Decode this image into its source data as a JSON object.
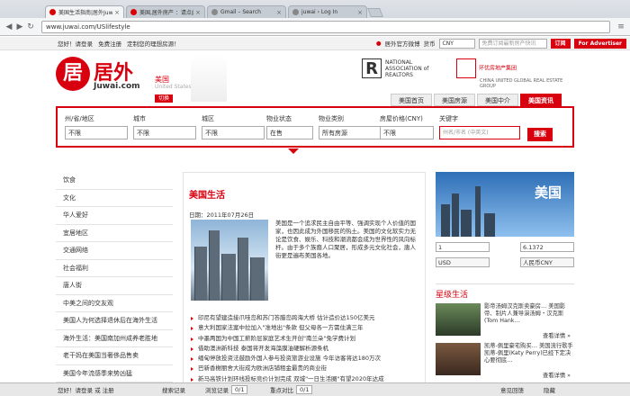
{
  "browser": {
    "tabs": [
      "美国生活指南|居外Juwai.co",
      "美国,居外房产 ：请点此分",
      "Gmail – Search",
      "juwai › Log In"
    ],
    "url": "www.juwai.com/USlifestyle"
  },
  "topbar": {
    "greeting": "您好！请登录",
    "free_reg": "免费注册",
    "custom": "定制您的理想房源！",
    "weibo": "居外官方微博",
    "currency_label": "货币",
    "currency": "CNY",
    "sub_placeholder": "免费订阅最新房产快讯",
    "subscribe": "订阅",
    "advertiser": "For Advertiser"
  },
  "header": {
    "logo_char": "居",
    "brand": "居外",
    "brand_sub": "Juwai.com",
    "region": "美国",
    "region_en": "United States",
    "switch": "切换",
    "realtor": "NATIONAL ASSOCIATION of REALTORS",
    "realtor_mark": "R",
    "ugre": "环优房地产集团",
    "ugre_en": "CHINA UNITED GLOBAL REAL ESTATE GROUP"
  },
  "nav": [
    "美国首页",
    "美国房源",
    "美国中介",
    "美国资讯"
  ],
  "search": {
    "fields": [
      {
        "label": "州/省/地区",
        "value": "不限"
      },
      {
        "label": "城市",
        "value": "不限"
      },
      {
        "label": "城区",
        "value": "不限"
      },
      {
        "label": "物业状态",
        "value": "在售"
      },
      {
        "label": "物业类别",
        "value": "所有房源"
      },
      {
        "label": "房屋价格(CNY)",
        "value": "不限"
      }
    ],
    "keyword_label": "关键字",
    "keyword_placeholder": "州名/市名 (中英文)",
    "button": "搜索"
  },
  "sidebar": [
    "饮食",
    "文化",
    "华人爱好",
    "宜居地区",
    "交通网络",
    "社会福利",
    "唐人街",
    "中美之间的交友观",
    "美国人为何选择退休后在海外生活",
    "海外生活：美国南加州成养老胜地",
    "老干妈在美国当奢侈品售卖",
    "美国今年流感季来势凶猛"
  ],
  "article": {
    "title": "美国生活",
    "date": "日期：2011年07月26日",
    "body": "美国是一个追求民主自由平等、强调实现个人价值的国家，也因此成为外国移民的热土。美国的文化软实力无论是饮食、娱乐、科技和潮流都会成为世界性的风向标杆。由于多个族裔人口聚居，形成多元文化社会，唐人街更是遍布美国各地。",
    "links": [
      "印尼有望建造接爪哇岛和苏门答腊岛跨海大桥 估计造价达150亿美元",
      "意大利国家法案中拉加入\"准地出\"条款 但父母各一方需住满三年",
      "中墨两国为中国工薪阶层家庭艺术生开创\"南兰朵\"免学费计划",
      "借助澳洲新科技 泰国将开发海藻膜油硬解析源条机",
      "缅甸停放投资法鼓励外国人参与投资旅游业设施 今年访客将达180万次",
      "巴新香榭丽舍大街成为欧洲店铺租金最贵的商业街",
      "新马高铁计划环线投标竞价计划完成 双城\"一日生活圈\"有望2020年达成"
    ]
  },
  "right": {
    "country": "美国",
    "amount": "1",
    "rate": "6.1372",
    "from": "USD",
    "to": "人民币CNY",
    "section": "星级生活",
    "items": [
      {
        "text": "影帝汤姆汉克斯卖豪房… 美国影帝、制片人兼导演汤姆・汉克斯(Tom Hank…",
        "more": "查看详情 »"
      },
      {
        "text": "凯蒂-佩里豪宅购买… 美国流行歌手凯蒂-佩里(Katy Perry)已经下定决心要彻底…",
        "more": "查看详情 »"
      }
    ]
  },
  "bottom": {
    "greeting": "您好！请登录 或 注册",
    "search_log": "搜索记录",
    "browse_log": "浏览记录",
    "browse_count": "0/1",
    "compare_log": "重点对比",
    "compare_count": "0/1",
    "feedback": "意见回馈",
    "hide": "隐藏"
  }
}
